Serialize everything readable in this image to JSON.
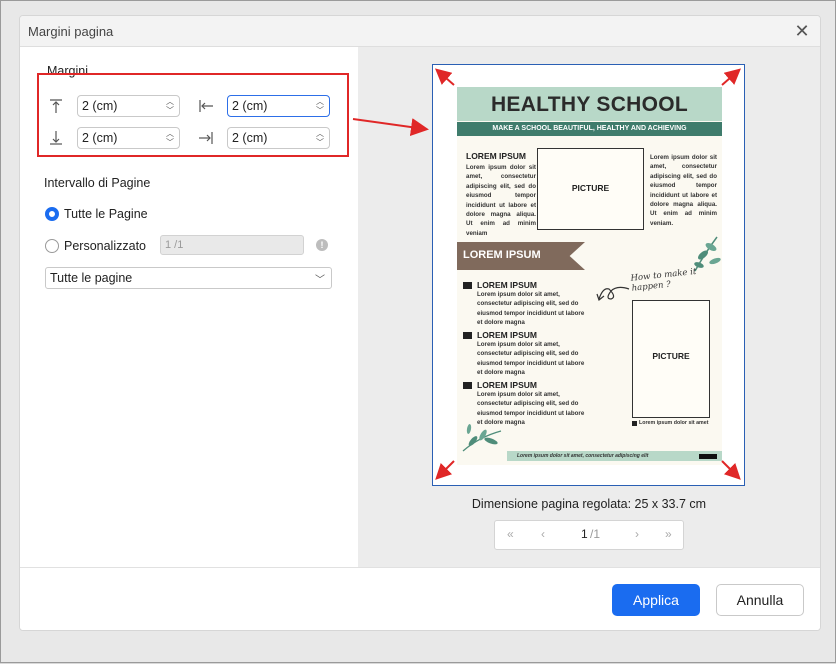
{
  "dialog": {
    "title": "Margini pagina",
    "close_icon": "close-icon"
  },
  "margins": {
    "section_label": "Margini",
    "top": {
      "value": "2 (cm)",
      "icon": "margin-top-icon"
    },
    "left": {
      "value": "2 (cm)",
      "icon": "margin-left-icon"
    },
    "bottom": {
      "value": "2 (cm)",
      "icon": "margin-bottom-icon"
    },
    "right": {
      "value": "2 (cm)",
      "icon": "margin-right-icon"
    }
  },
  "page_range": {
    "section_label": "Intervallo di Pagine",
    "all_pages_label": "Tutte le Pagine",
    "custom_label": "Personalizzato",
    "custom_placeholder": "1 /1",
    "subset_select": "Tutte le pagine",
    "selected": "all"
  },
  "preview": {
    "poster": {
      "title": "HEALTHY SCHOOL",
      "subtitle": "MAKE A SCHOOL BEAUTIFUL, HEALTHY AND ACHIEVING",
      "heading1": "LOREM IPSUM",
      "col1_text": "Lorem ipsum dolor sit amet, consectetur adipiscing elit, sed do eiusmod tempor incididunt ut labore et dolore magna aliqua. Ut enim ad minim veniam",
      "picture_label": "PICTURE",
      "col3_text": "Lorem ipsum dolor sit amet, consectetur adipiscing elit, sed do eiusmod tempor incididunt ut labore et dolore magna aliqua. Ut enim ad minim veniam.",
      "ribbon": "LOREM IPSUM",
      "script_text": "How to make it happen ?",
      "items": [
        {
          "heading": "LOREM IPSUM",
          "text": "Lorem ipsum dolor sit amet, consectetur adipiscing elit, sed do eiusmod tempor incididunt ut labore et dolore magna"
        },
        {
          "heading": "LOREM IPSUM",
          "text": "Lorem ipsum dolor sit amet, consectetur adipiscing elit, sed do eiusmod tempor incididunt ut labore et dolore magna"
        },
        {
          "heading": "LOREM IPSUM",
          "text": "Lorem ipsum dolor sit amet, consectetur adipiscing elit, sed do eiusmod tempor incididunt ut labore et dolore magna"
        }
      ],
      "picture2_label": "PICTURE",
      "picture2_caption": "Lorem ipsum dolor sit amet",
      "footer_text": "Lorem ipsum dolor sit amet, consectetur adipiscing elit"
    },
    "page_size_text": "Dimensione pagina regolata: 25 x 33.7 cm",
    "pager": {
      "current": "1",
      "total": "/1"
    }
  },
  "buttons": {
    "apply": "Applica",
    "cancel": "Annulla"
  },
  "colors": {
    "accent": "#1a6cf0",
    "highlight": "#e02727",
    "poster_green": "#b8d8c8",
    "poster_dark_green": "#3f7c6c",
    "ribbon_brown": "#806a5c"
  }
}
